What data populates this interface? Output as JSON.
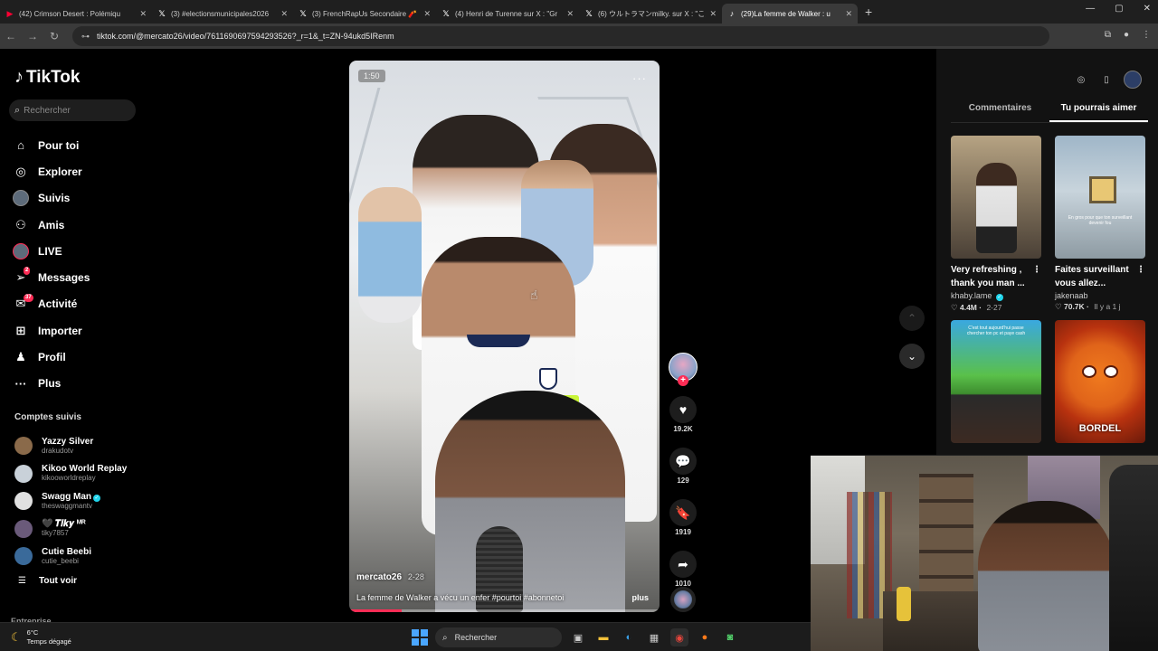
{
  "browser": {
    "tabs": [
      {
        "title": "(42) Crimson Desert : Polémiqu",
        "icon": "youtube-icon",
        "color": "#ff0033",
        "active": false
      },
      {
        "title": "(3) #electionsmunicipales2026",
        "icon": "x-icon",
        "color": "#ffffff",
        "active": false
      },
      {
        "title": "(3) FrenchRapUs Secondaire 🧨",
        "icon": "x-icon",
        "color": "#ffffff",
        "active": false
      },
      {
        "title": "(4) Henri de Turenne sur X : \"Gr",
        "icon": "x-icon",
        "color": "#ffffff",
        "active": false
      },
      {
        "title": "(6) ウルトラマンmilky. sur X : \"こん",
        "icon": "x-icon",
        "color": "#ffffff",
        "active": false
      },
      {
        "title": "(29)La femme de Walker : u",
        "icon": "tiktok-icon",
        "color": "#ffffff",
        "active": true
      }
    ],
    "url": "tiktok.com/@mercato26/video/7611690697594293526?_r=1&_t=ZN-94ukd5IRenm"
  },
  "sidebar": {
    "brand": "TikTok",
    "search_placeholder": "Rechercher",
    "nav": [
      {
        "label": "Pour toi",
        "icon": "home-icon",
        "badge": ""
      },
      {
        "label": "Explorer",
        "icon": "compass-icon",
        "badge": ""
      },
      {
        "label": "Suivis",
        "icon": "following-avatar-icon",
        "badge": ""
      },
      {
        "label": "Amis",
        "icon": "friends-icon",
        "badge": ""
      },
      {
        "label": "LIVE",
        "icon": "live-avatar-icon",
        "badge": ""
      },
      {
        "label": "Messages",
        "icon": "messages-icon",
        "badge": "2"
      },
      {
        "label": "Activité",
        "icon": "activity-icon",
        "badge": "37"
      },
      {
        "label": "Importer",
        "icon": "upload-icon",
        "badge": ""
      },
      {
        "label": "Profil",
        "icon": "profile-icon",
        "badge": ""
      },
      {
        "label": "Plus",
        "icon": "more-icon",
        "badge": ""
      }
    ],
    "following_heading": "Comptes suivis",
    "following": [
      {
        "name": "Yazzy Silver",
        "handle": "drakudotv",
        "verified": false,
        "color": "#8a6a4a"
      },
      {
        "name": "Kikoo World Replay",
        "handle": "kikooworldreplay",
        "verified": false,
        "color": "#c9d1d9"
      },
      {
        "name": "Swagg Man",
        "handle": "theswaggmantv",
        "verified": true,
        "color": "#e0e0e0"
      },
      {
        "name": "🖤 𝑻𝒊𝒌𝒚 ᴹᴿ",
        "handle": "tiky7857",
        "verified": false,
        "color": "#6a5a7a"
      },
      {
        "name": "Cutie Beebi",
        "handle": "cutie_beebi",
        "verified": false,
        "color": "#3a6a9a"
      }
    ],
    "see_all": "Tout voir",
    "business": "Entreprise"
  },
  "video": {
    "timer": "1:50",
    "author": "mercato26",
    "date": "2-28",
    "caption": "La femme de Walker a vécu un enfer #pourtoi #abonnetoi",
    "more": "plus",
    "progress": 0.17
  },
  "actions": [
    {
      "name": "like-button",
      "icon": "heart-icon",
      "glyph": "♥",
      "count": "19.2K"
    },
    {
      "name": "comment-button",
      "icon": "comment-icon",
      "glyph": "💬",
      "count": "129"
    },
    {
      "name": "save-button",
      "icon": "bookmark-icon",
      "glyph": "🔖",
      "count": "1919"
    },
    {
      "name": "share-button",
      "icon": "share-icon",
      "glyph": "➦",
      "count": "1010"
    }
  ],
  "right_panel": {
    "tabs": [
      "Commentaires",
      "Tu pourrais aimer"
    ],
    "active_tab": 1,
    "cards": [
      {
        "title": "Very refreshing , thank you man ...",
        "user": "khaby.lame",
        "verified": true,
        "likes": "4.4M",
        "date": "2-27"
      },
      {
        "title": "Faites surveillant vous allez...",
        "user": "jakenaab",
        "verified": false,
        "likes": "70.7K",
        "date": "Il y a 1 j"
      },
      {
        "title": "",
        "user": "",
        "verified": false,
        "likes": "",
        "date": "",
        "thumb_text": "C'est tout aujourd'hui passe chercher ton pc et paye cash"
      },
      {
        "title": "",
        "user": "",
        "verified": false,
        "likes": "",
        "date": "",
        "thumb_text": "BORDEL"
      }
    ]
  },
  "thumb2_text": "En gros pour que ton surveillant devenir fou",
  "taskbar": {
    "temp": "6°C",
    "weather": "Temps dégagé",
    "search": "Rechercher"
  }
}
